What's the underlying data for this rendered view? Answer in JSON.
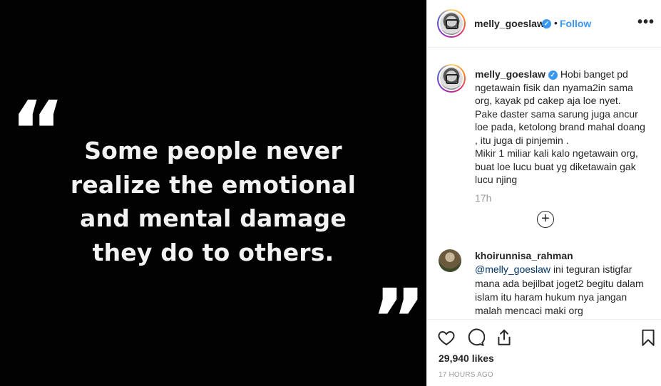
{
  "post": {
    "quote_open": "“",
    "quote_close": "”",
    "quote_lines": [
      "Some people never",
      "realize the emotional",
      "and mental damage",
      "they do to others."
    ]
  },
  "header": {
    "username": "melly_goeslaw",
    "verified_mark": "✓",
    "separator": "•",
    "follow_label": "Follow",
    "more_label": "•••"
  },
  "caption": {
    "username": "melly_goeslaw",
    "verified_mark": "✓",
    "text": "Hobi banget pd ngetawain fisik dan nyama2in sama org, kayak pd cakep aja loe nyet. Pake daster sama sarung juga ancur loe pada, ketolong brand mahal doang , itu juga di pinjemin .\nMikir 1 miliar kali kalo ngetawain org, buat loe lucu buat yg diketawain gak lucu njing",
    "time": "17h",
    "load_more": "+"
  },
  "comment": {
    "username": "khoirunnisa_rahman",
    "mention": "@melly_goeslaw",
    "text": "ini teguran istigfar mana ada bejilbat joget2 begitu dalam islam itu haram hukum nya jangan malah mencaci maki org"
  },
  "actions": {
    "icons": [
      "heart-icon",
      "comment-icon",
      "share-icon",
      "bookmark-icon"
    ],
    "likes": "29,940 likes",
    "time_ago": "17 HOURS AGO"
  },
  "colors": {
    "accent": "#3897f0",
    "mention": "#003569",
    "muted": "#999999",
    "post_background": "#020202"
  }
}
